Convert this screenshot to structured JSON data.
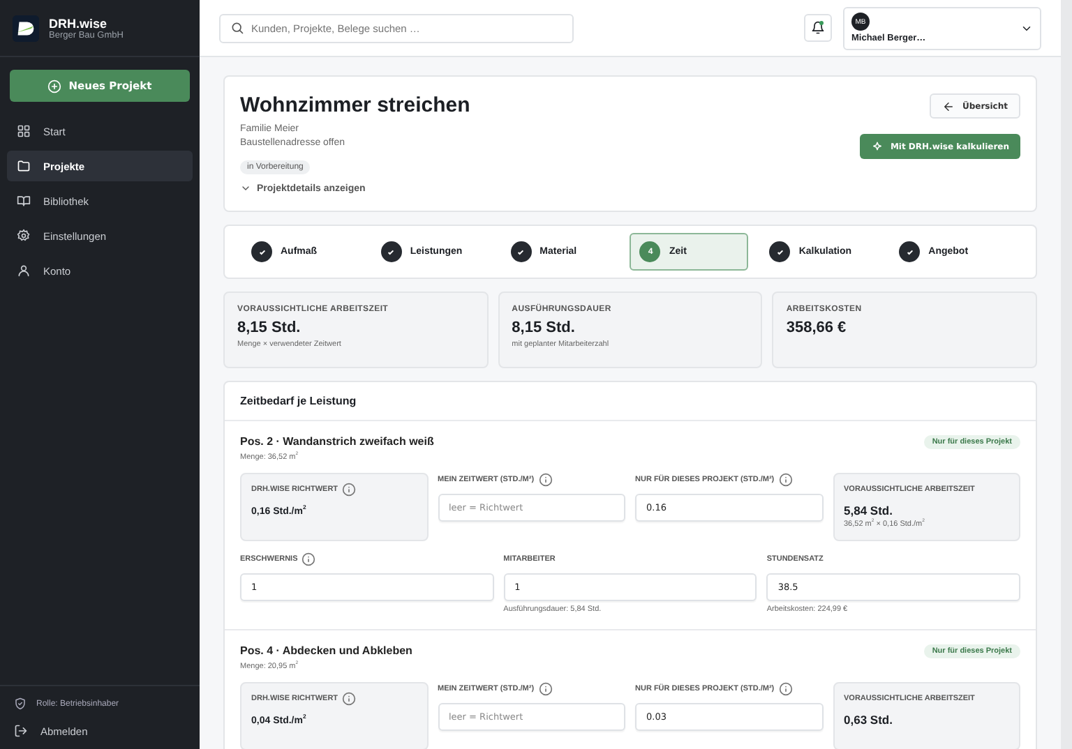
{
  "sidebar": {
    "brand": "DRH.wise",
    "company": "Berger Bau GmbH",
    "new_button": "Neues Projekt",
    "items": [
      {
        "label": "Start",
        "selected": false
      },
      {
        "label": "Projekte",
        "selected": true
      },
      {
        "label": "Bibliothek",
        "selected": false
      },
      {
        "label": "Einstellungen",
        "selected": false
      },
      {
        "label": "Konto",
        "selected": false
      }
    ],
    "role": "Rolle: Betriebsinhaber",
    "logout": "Abmelden"
  },
  "topbar": {
    "search": {
      "placeholder": "Kunden, Projekte, Belege suchen …"
    },
    "notification_dot": true,
    "user": {
      "initials": "MB",
      "name": "Michael Berger…"
    }
  },
  "project": {
    "title": "Wohnzimmer streichen",
    "customer": "Familie Meier",
    "address": "Baustellenadresse offen",
    "status": "in Vorbereitung",
    "details_toggle": "Projektdetails anzeigen",
    "back_button": "Übersicht",
    "calc_button": "Mit DRH.wise kalkulieren"
  },
  "steps": [
    {
      "label": "Aufmaß",
      "completed": true,
      "selected": false
    },
    {
      "label": "Leistungen",
      "completed": true,
      "selected": false
    },
    {
      "label": "Material",
      "completed": true,
      "selected": false
    },
    {
      "label": "Zeit",
      "number": "4",
      "completed": false,
      "selected": true
    },
    {
      "label": "Kalkulation",
      "completed": true,
      "selected": false
    },
    {
      "label": "Angebot",
      "completed": true,
      "selected": false
    }
  ],
  "stats": [
    {
      "label": "VORAUSSICHTLICHE ARBEITSZEIT",
      "value": "8,15 Std.",
      "note": "Menge × verwendeter Zeitwert"
    },
    {
      "label": "AUSFÜHRUNGSDAUER",
      "value": "8,15 Std.",
      "note": "mit geplanter Mitarbeiterzahl"
    },
    {
      "label": "ARBEITSKOSTEN",
      "value": "358,66 €"
    }
  ],
  "time_section": {
    "title": "Zeitbedarf je Leistung",
    "positions": [
      {
        "title": "Pos. 2 · Wandanstrich zweifach weiß",
        "quantity": "Menge: 36,52 m$^{2}$",
        "badge": "Nur für dieses Projekt",
        "row_1": [
          {
            "kind": "readout",
            "label": "DRH.WISE RICHTWERT",
            "info": true,
            "value": "0,16 Std./m$^{2}$"
          },
          {
            "kind": "field",
            "label": "MEIN ZEITWERT (STD./M²)",
            "info": true,
            "placeholder": "leer = Richtwert"
          },
          {
            "kind": "field",
            "label": "NUR FÜR DIESES PROJEKT (STD./M²)",
            "info": true,
            "value": "0.16"
          },
          {
            "kind": "result",
            "label": "VORAUSSICHTLICHE ARBEITSZEIT",
            "info": false,
            "value": "5,84 Std.",
            "note": "36,52 m$^{2}$ × 0,16 Std./m$^{2}$"
          }
        ],
        "row_2": [
          {
            "kind": "field",
            "label": "ERSCHWERNIS",
            "info": true,
            "value": "1"
          },
          {
            "kind": "field",
            "label": "MITARBEITER",
            "info": false,
            "value": "1",
            "note": "Ausführungsdauer: 5,84 Std."
          },
          {
            "kind": "field",
            "label": "STUNDENSATZ",
            "info": false,
            "value": "38.5",
            "note": "Arbeitskosten: 224,99 €"
          }
        ]
      },
      {
        "title": "Pos. 4 · Abdecken und Abkleben",
        "quantity": "Menge: 20,95 m$^{2}$",
        "badge": "Nur für dieses Projekt",
        "row_1": [
          {
            "kind": "readout",
            "label": "DRH.WISE RICHTWERT",
            "info": true,
            "value": "0,04 Std./m$^{2}$"
          },
          {
            "kind": "field",
            "label": "MEIN ZEITWERT (STD./M²)",
            "info": true,
            "placeholder": "leer = Richtwert"
          },
          {
            "kind": "field",
            "label": "NUR FÜR DIESES PROJEKT (STD./M²)",
            "info": true,
            "value": "0.03"
          },
          {
            "kind": "result",
            "label": "VORAUSSICHTLICHE ARBEITSZEIT",
            "info": false,
            "value": "0,63 Std."
          }
        ]
      }
    ]
  }
}
